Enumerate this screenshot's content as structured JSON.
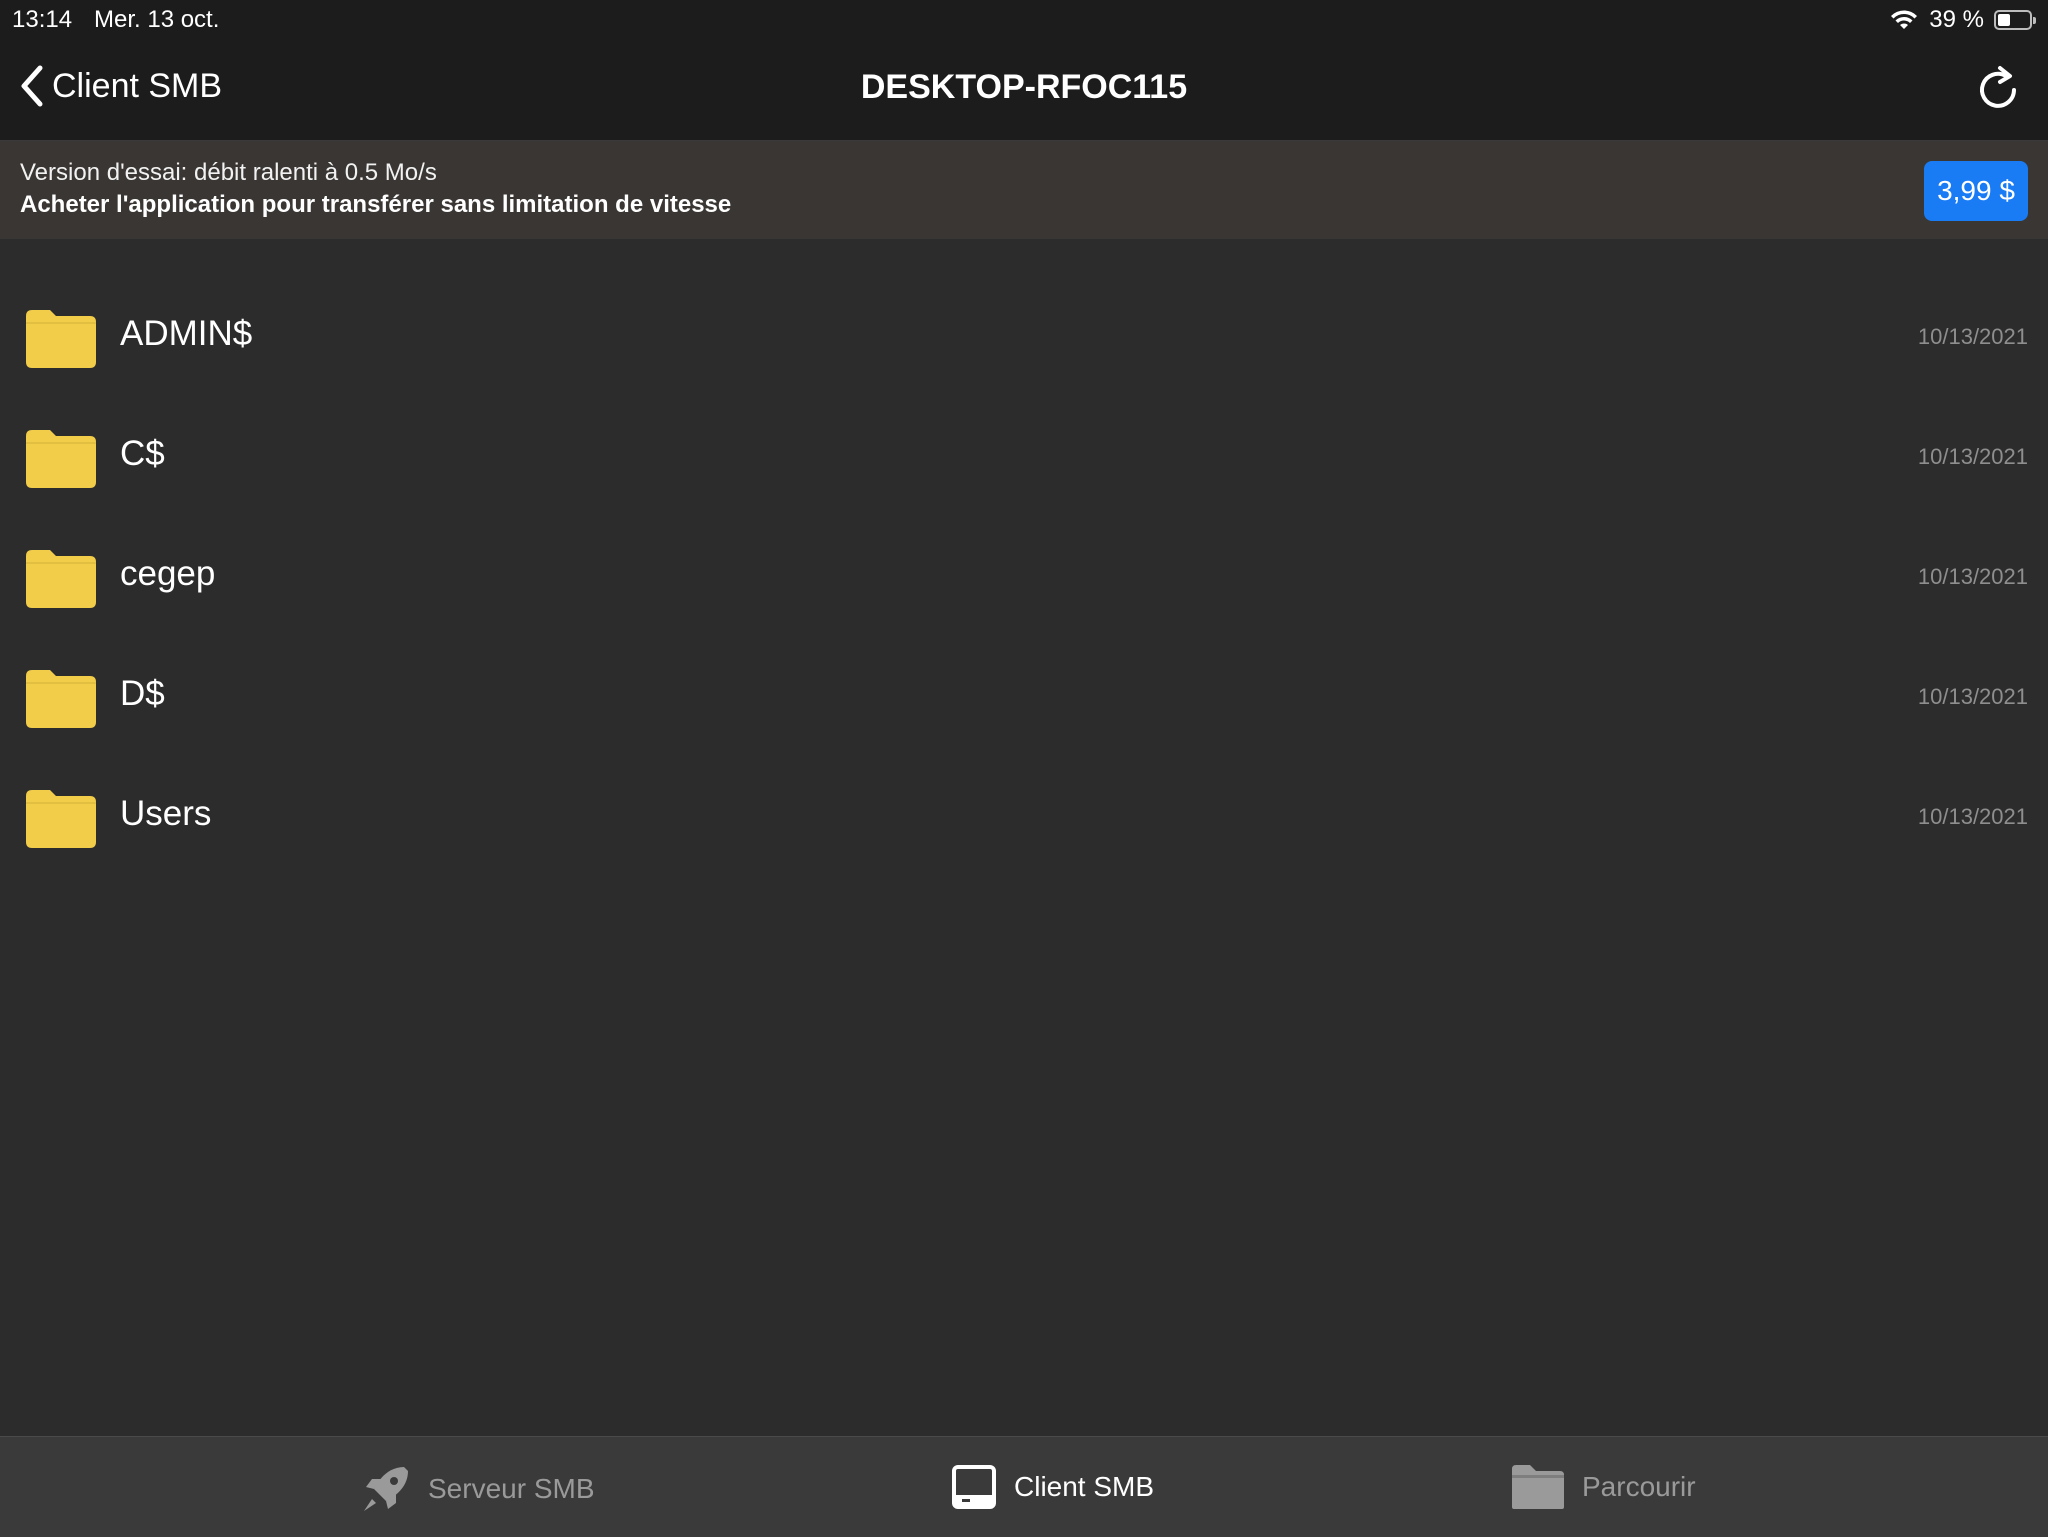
{
  "status_bar": {
    "time": "13:14",
    "date": "Mer. 13 oct.",
    "battery_text": "39 %",
    "battery_level": 0.39,
    "wifi_icon": "wifi-icon"
  },
  "nav": {
    "back_label": "Client SMB",
    "title": "DESKTOP-RFOC115",
    "refresh_icon": "refresh-icon"
  },
  "trial_banner": {
    "line1": "Version d'essai: débit ralenti à 0.5 Mo/s",
    "line2": "Acheter l'application pour transférer sans limitation de vitesse",
    "buy_label": "3,99 $",
    "buy_color": "#1a7cf5"
  },
  "files": [
    {
      "name": "ADMIN$",
      "date": "10/13/2021"
    },
    {
      "name": "C$",
      "date": "10/13/2021"
    },
    {
      "name": "cegep",
      "date": "10/13/2021"
    },
    {
      "name": "D$",
      "date": "10/13/2021"
    },
    {
      "name": "Users",
      "date": "10/13/2021"
    }
  ],
  "folder_color": "#f2cd4a",
  "tabs": [
    {
      "label": "Serveur SMB",
      "icon": "rocket-icon",
      "active": false
    },
    {
      "label": "Client SMB",
      "icon": "laptop-icon",
      "active": true
    },
    {
      "label": "Parcourir",
      "icon": "folder-icon",
      "active": false
    }
  ]
}
